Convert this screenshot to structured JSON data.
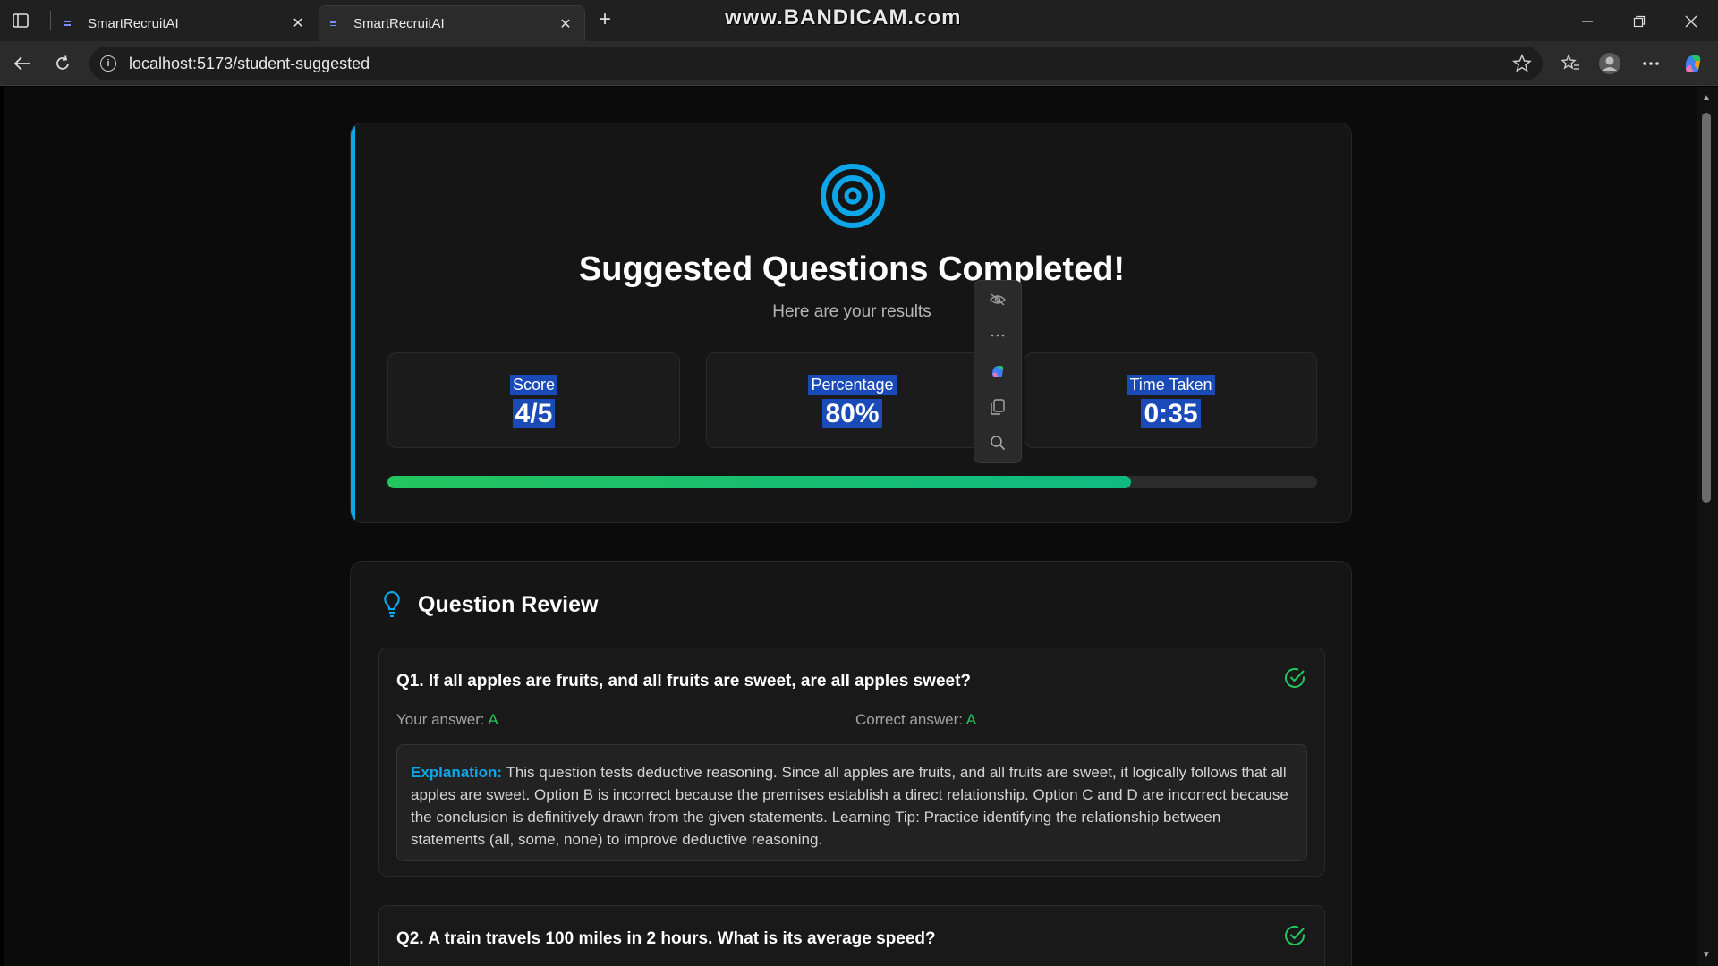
{
  "browser": {
    "tabs": [
      {
        "title": "SmartRecruitAI",
        "active": false
      },
      {
        "title": "SmartRecruitAI",
        "active": true
      }
    ],
    "url": "localhost:5173/student-suggested",
    "watermark": "www.BANDICAM.com"
  },
  "results": {
    "title": "Suggested Questions Completed!",
    "subtitle": "Here are your results",
    "stats": [
      {
        "label": "Score",
        "value": "4/5"
      },
      {
        "label": "Percentage",
        "value": "80%"
      },
      {
        "label": "Time Taken",
        "value": "0:35"
      }
    ],
    "progress_fraction": 0.8
  },
  "review": {
    "title": "Question Review",
    "questions": [
      {
        "text": "Q1. If all apples are fruits, and all fruits are sweet, are all apples sweet?",
        "your_answer_label": "Your answer:",
        "your_answer": "A",
        "correct_answer_label": "Correct answer:",
        "correct_answer": "A",
        "explanation_label": "Explanation:",
        "explanation": "This question tests deductive reasoning. Since all apples are fruits, and all fruits are sweet, it logically follows that all apples are sweet. Option B is incorrect because the premises establish a direct relationship. Option C and D are incorrect because the conclusion is definitively drawn from the given statements. Learning Tip: Practice identifying the relationship between statements (all, some, none) to improve deductive reasoning."
      },
      {
        "text": "Q2. A train travels 100 miles in 2 hours. What is its average speed?"
      }
    ]
  },
  "colors": {
    "accent": "#0ea5e9",
    "success": "#22c55e",
    "selection": "#1a49b8"
  }
}
